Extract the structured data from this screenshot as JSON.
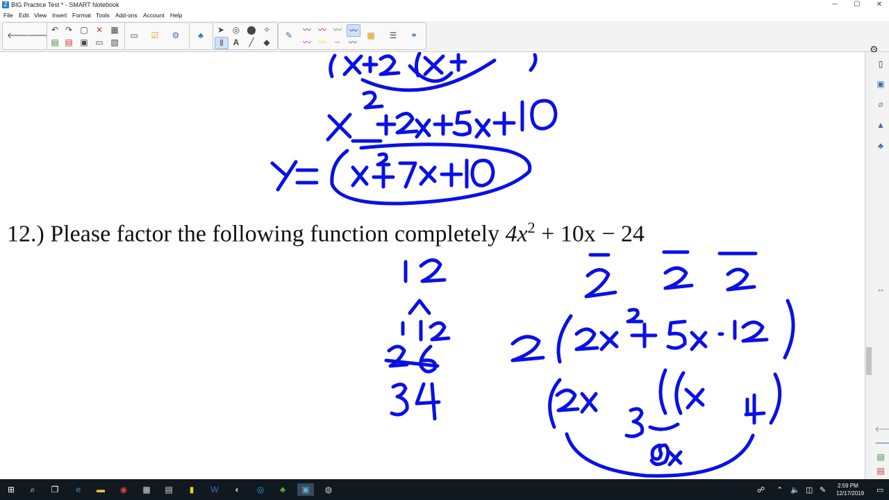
{
  "window": {
    "title": "BIG Practice Test * - SMART Notebook",
    "app_glyph": "Z",
    "minimize": "─",
    "maximize": "☐",
    "close": "✕"
  },
  "menu": [
    "File",
    "Edit",
    "View",
    "Insert",
    "Format",
    "Tools",
    "Add-ons",
    "Account",
    "Help"
  ],
  "question": {
    "prefix": "12.) Please factor the following function completely ",
    "math": "4x",
    "exp": "2",
    "rest": " + 10x − 24"
  },
  "taskbar": {
    "time": "2:59 PM",
    "date": "12/17/2019"
  },
  "colors": {
    "ink": "#0a10e6",
    "taskbar": "#101820"
  }
}
